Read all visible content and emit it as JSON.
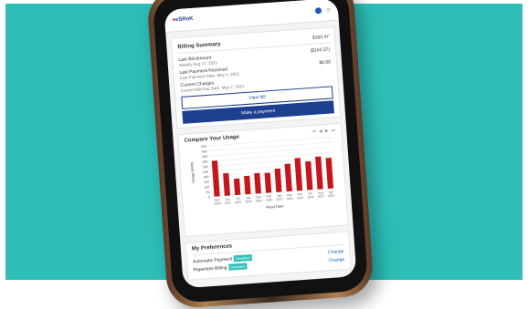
{
  "header": {
    "logo_text": "eSRoK"
  },
  "billing": {
    "title": "Billing Summary",
    "total": "$162.47",
    "last_bill_label": "Last Bill Amount",
    "last_bill_sub": "Weekly Aug 17, 2021",
    "last_bill_value": "($163.37)",
    "last_payment_label": "Last Payment Received",
    "last_payment_sub": "Last Payment Date: May 4, 2021",
    "last_payment_value": "$0.00",
    "current_label": "Current Charges",
    "current_sub": "Current Bill Due Date: May 7, 2021",
    "view_bill": "View bill",
    "make_payment": "Make a payment"
  },
  "usage": {
    "title": "Compare Your Usage",
    "nav_prev": "◀",
    "nav_first": "⏮",
    "nav_next": "▶",
    "nav_last": "⏭"
  },
  "chart_data": {
    "type": "bar",
    "categories": [
      "Nov 2020",
      "Jan 2021",
      "Jul 2021",
      "Jan 2022",
      "Mar 2022",
      "Feb 2022",
      "Jan 2022",
      "Dec 2021",
      "Nov 2022",
      "Oct 2022",
      "Aug 2022",
      "Apr 2022"
    ],
    "values": [
      350,
      220,
      160,
      180,
      200,
      195,
      230,
      270,
      320,
      280,
      320,
      300
    ],
    "ylabel": "Usage (kWh)",
    "xlabel": "Read Date",
    "yticks": [
      "500",
      "450",
      "400",
      "350",
      "300",
      "250",
      "200",
      "150",
      "100",
      "50",
      "0"
    ],
    "ylim": [
      0,
      500
    ],
    "bar_color": "#c4171c"
  },
  "preferences": {
    "title": "My Preferences",
    "autopay_label": "Automatic Payment",
    "autopay_badge": "Disabled",
    "paperless_label": "Paperless Billing",
    "paperless_badge": "Disabled",
    "change1": "Change",
    "change2": "Change"
  },
  "colors": {
    "background": "#2dbdb6",
    "primary": "#1d3f8f",
    "bar": "#c4171c"
  }
}
